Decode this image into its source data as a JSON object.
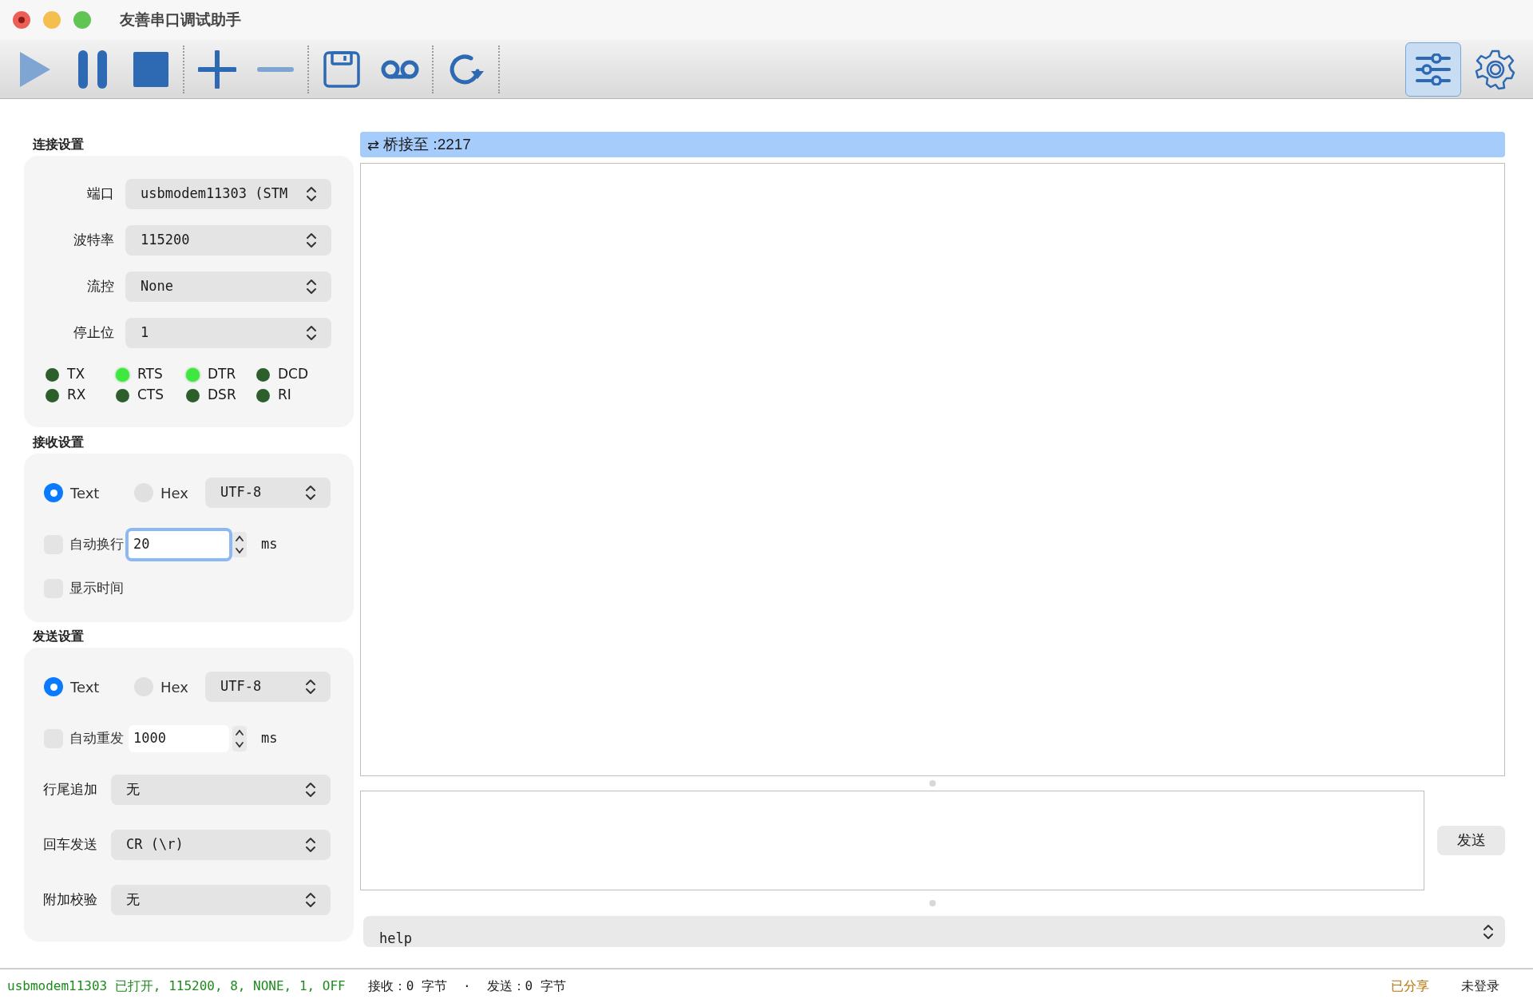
{
  "window": {
    "title": "友善串口调试助手"
  },
  "toolbar": {
    "groups": [
      [
        {
          "kind": "play",
          "disabled": true
        },
        {
          "kind": "pause",
          "disabled": false
        },
        {
          "kind": "stop",
          "disabled": false
        }
      ],
      [
        {
          "kind": "plus",
          "disabled": false
        },
        {
          "kind": "minus",
          "disabled": true
        }
      ],
      [
        {
          "kind": "save",
          "disabled": false
        },
        {
          "kind": "tape",
          "disabled": false
        }
      ],
      [
        {
          "kind": "refresh",
          "disabled": false
        }
      ]
    ],
    "right": [
      {
        "kind": "sliders",
        "selected": true
      },
      {
        "kind": "gear",
        "selected": false
      }
    ]
  },
  "connection": {
    "title": "连接设置",
    "fields": [
      {
        "label": "端口",
        "value": "usbmodem11303 (STM"
      },
      {
        "label": "波特率",
        "value": "115200"
      },
      {
        "label": "流控",
        "value": "None"
      },
      {
        "label": "停止位",
        "value": "1"
      }
    ],
    "signals": [
      {
        "name": "TX",
        "on": false
      },
      {
        "name": "RTS",
        "on": true
      },
      {
        "name": "DTR",
        "on": true
      },
      {
        "name": "DCD",
        "on": false
      },
      {
        "name": "RX",
        "on": false
      },
      {
        "name": "CTS",
        "on": false
      },
      {
        "name": "DSR",
        "on": false
      },
      {
        "name": "RI",
        "on": false
      }
    ]
  },
  "receive": {
    "title": "接收设置",
    "modes": [
      {
        "label": "Text",
        "selected": true
      },
      {
        "label": "Hex",
        "selected": false
      }
    ],
    "encoding": "UTF-8",
    "options": [
      {
        "kind": "interval",
        "label": "自动换行",
        "checked": false,
        "value": "20",
        "unit": "ms",
        "focused": true
      },
      {
        "kind": "plain",
        "label": "显示时间",
        "checked": false
      }
    ]
  },
  "send": {
    "title": "发送设置",
    "modes": [
      {
        "label": "Text",
        "selected": true
      },
      {
        "label": "Hex",
        "selected": false
      }
    ],
    "encoding": "UTF-8",
    "options": [
      {
        "kind": "interval",
        "label": "自动重发",
        "checked": false,
        "value": "1000",
        "unit": "ms",
        "focused": false
      }
    ],
    "fields": [
      {
        "label": "行尾追加",
        "value": "无"
      },
      {
        "label": "回车发送",
        "value": "CR (\\r)"
      },
      {
        "label": "附加校验",
        "value": "无"
      }
    ]
  },
  "bridge": {
    "icon": "⇄",
    "text": "桥接至 :2217"
  },
  "send_button": "发送",
  "command": {
    "value": "help"
  },
  "status_bar": {
    "connection": "usbmodem11303 已打开, 115200, 8, NONE, 1, OFF",
    "received": "接收：0 字节",
    "separator": "·",
    "sent": "发送：0 字节",
    "shared": "已分享",
    "login": "未登录"
  }
}
